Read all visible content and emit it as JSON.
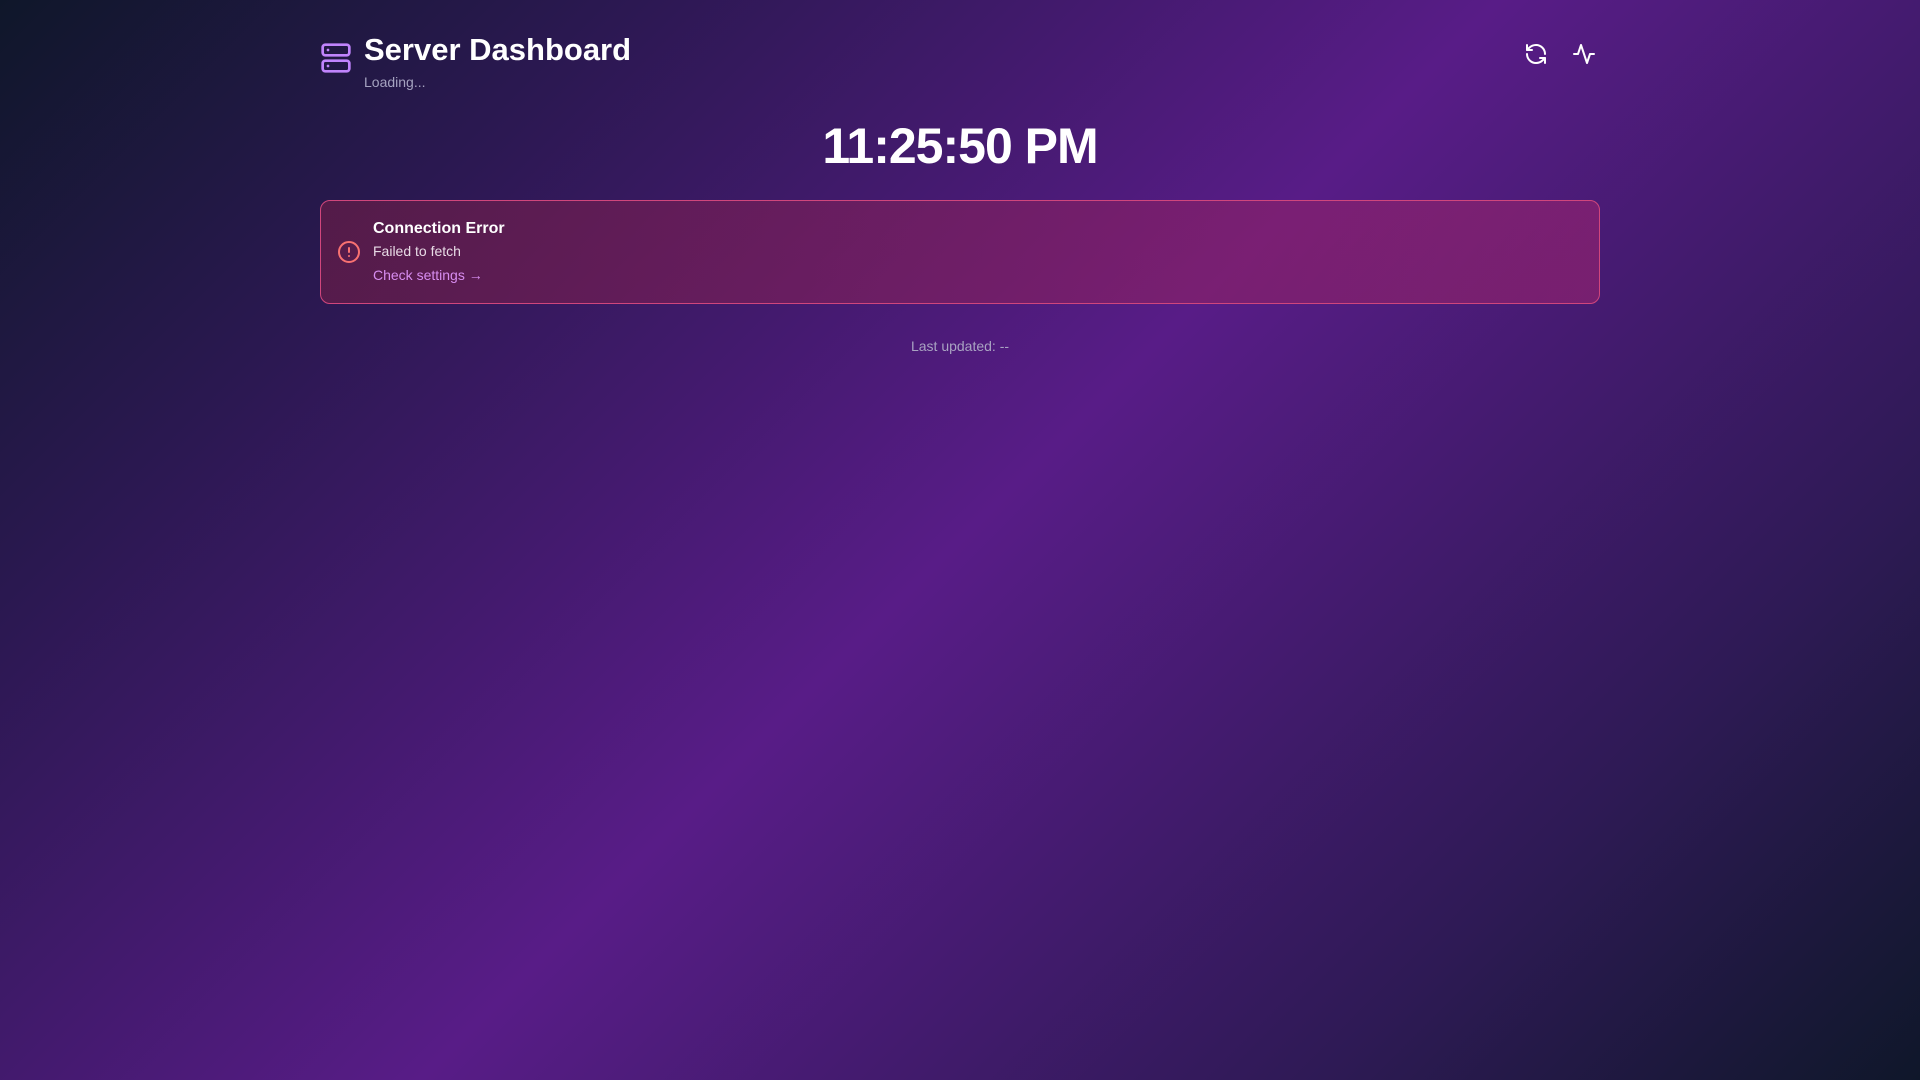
{
  "header": {
    "title": "Server Dashboard",
    "subtitle": "Loading...",
    "icons": {
      "brand": "server-icon",
      "refresh": "refresh-icon",
      "activity": "activity-icon"
    }
  },
  "clock": {
    "time": "11:25:50 PM"
  },
  "error": {
    "title": "Connection Error",
    "message": "Failed to fetch",
    "link_label": "Check settings →",
    "icon": "alert-circle-icon"
  },
  "footer": {
    "last_updated": "Last updated: --"
  },
  "colors": {
    "accent": "#c084fc",
    "error_border": "#d0467c",
    "error_icon": "#f87171",
    "link": "#d78df0"
  }
}
